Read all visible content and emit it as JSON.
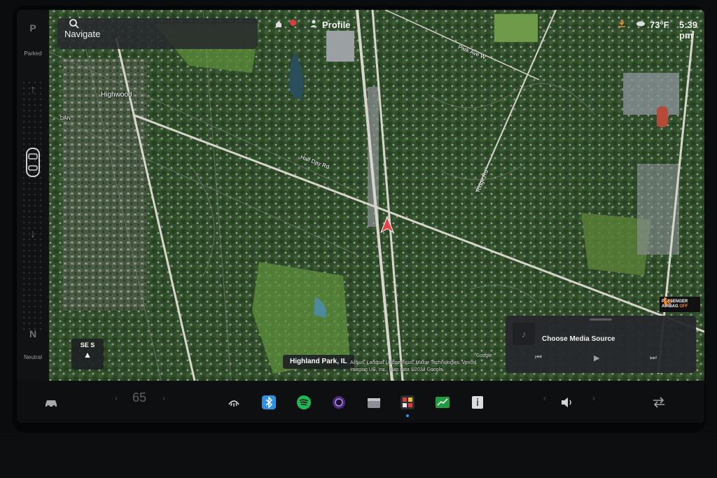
{
  "search": {
    "placeholder": "Navigate",
    "icon": "search-icon"
  },
  "header": {
    "profile_label": "Profile",
    "temperature": "73°F",
    "time": "5:39 pm"
  },
  "gear": {
    "top_letter": "P",
    "top_label": "Parked",
    "bottom_letter": "N",
    "bottom_label": "Neutral"
  },
  "map": {
    "place_labels": [
      "Highwood",
      "DAN"
    ],
    "road_labels": [
      "Half Day Rd",
      "Park Ave W",
      "Ridge Rd"
    ],
    "city": "Highland Park, IL",
    "compass_heading": "SE S",
    "attribution": [
      "Google",
      "Airbus, Landsat / Copernicus, Maxar Technologies, Vexcel Imaging US, Inc., Map data ©2024 Google"
    ]
  },
  "airbag": {
    "line1": "PASSENGER",
    "line2": "AIRBAG",
    "status": "OFF"
  },
  "media": {
    "title": "Choose Media Source"
  },
  "dock": {
    "speed": "65",
    "icons": [
      "car-icon",
      "defrost-icon",
      "bluetooth-icon",
      "spotify-icon",
      "camera-icon",
      "toybox-icon",
      "apps-icon",
      "stocks-icon",
      "manual-icon",
      "volume-icon",
      "swap-icon"
    ]
  },
  "colors": {
    "accent": "#3a8dff",
    "nav_arrow": "#e8424a",
    "bluetooth": "#2f8fe0",
    "spotify": "#1db954",
    "stocks": "#1f9d3e"
  }
}
